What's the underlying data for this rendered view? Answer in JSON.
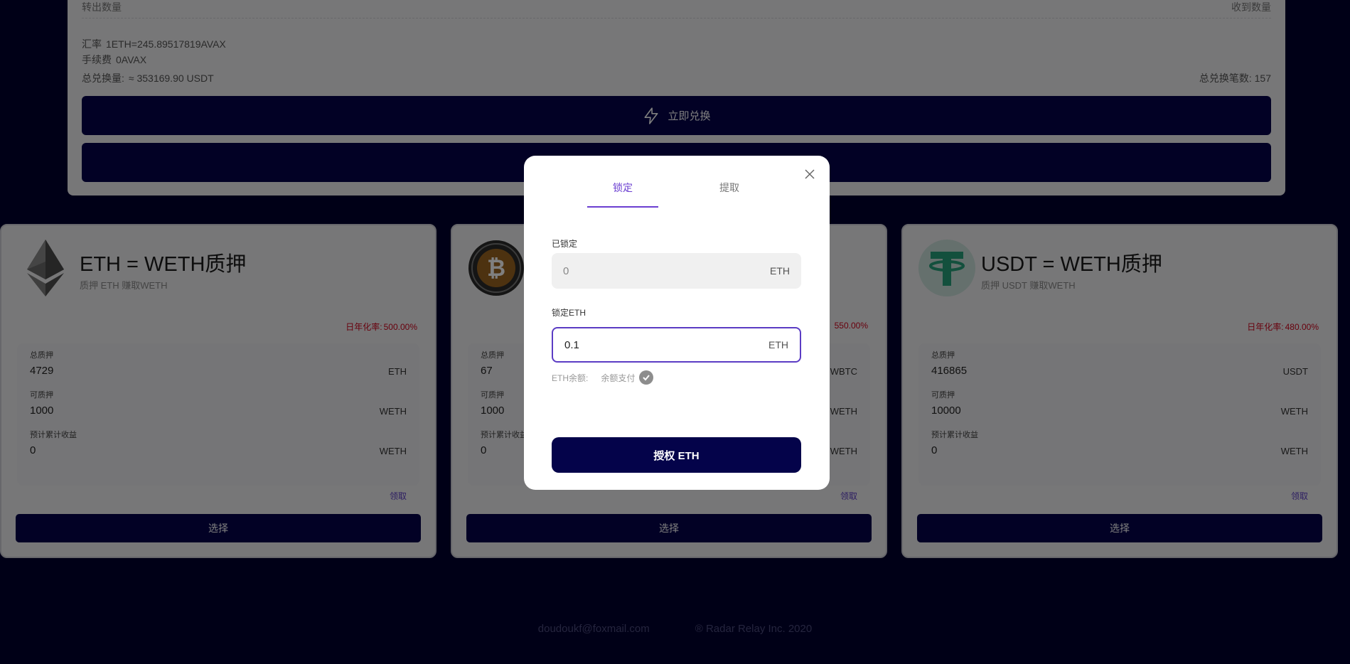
{
  "exchange": {
    "send_amount_label": "转出数量",
    "receive_amount_label": "收到数量",
    "rate_label": "汇率",
    "rate_value": "1ETH=245.89517819AVAX",
    "fee_label": "手续费",
    "fee_value": "0AVAX",
    "total_volume_label": "总兑换量:",
    "total_volume_value": "≈ 353169.90 USDT",
    "total_count_label": "总兑换笔数:",
    "total_count_value": "157",
    "exchange_button": "立即兑换"
  },
  "cards": [
    {
      "icon": "ethereum-icon",
      "title": "ETH = WETH质押",
      "subtitle": "质押 ETH 赚取WETH",
      "apy_label": "日年化率:",
      "apy_value": "500.00%",
      "total_stake_label": "总质押",
      "total_stake_value": "4729",
      "total_stake_unit": "ETH",
      "available_label": "可质押",
      "available_value": "1000",
      "available_unit": "WETH",
      "earnings_label": "预计累计收益",
      "earnings_value": "0",
      "earnings_unit": "WETH",
      "claim_label": "领取",
      "select_label": "选择"
    },
    {
      "icon": "bitcoin-icon",
      "title": "",
      "subtitle": "",
      "apy_label": "",
      "apy_value": "550.00%",
      "total_stake_label": "总质押",
      "total_stake_value": "67",
      "total_stake_unit": "WBTC",
      "available_label": "可质押",
      "available_value": "1000",
      "available_unit": "WETH",
      "earnings_label": "预计累计收益",
      "earnings_value": "0",
      "earnings_unit": "WETH",
      "claim_label": "领取",
      "select_label": "选择"
    },
    {
      "icon": "tether-icon",
      "title": "USDT = WETH质押",
      "subtitle": "质押 USDT 赚取WETH",
      "apy_label": "日年化率:",
      "apy_value": "480.00%",
      "total_stake_label": "总质押",
      "total_stake_value": "416865",
      "total_stake_unit": "USDT",
      "available_label": "可质押",
      "available_value": "10000",
      "available_unit": "WETH",
      "earnings_label": "预计累计收益",
      "earnings_value": "0",
      "earnings_unit": "WETH",
      "claim_label": "领取",
      "select_label": "选择"
    }
  ],
  "footer": {
    "email": "doudoukf@foxmail.com",
    "copyright": "® Radar Relay Inc. 2020"
  },
  "modal": {
    "tab_lock": "锁定",
    "tab_withdraw": "提取",
    "locked_label": "已锁定",
    "locked_value": "0",
    "locked_unit": "ETH",
    "lock_input_label": "锁定ETH",
    "lock_input_value": "0.1",
    "lock_input_unit": "ETH",
    "balance_label": "ETH余额:",
    "balance_pay_label": "余额支付",
    "approve_button": "授权 ETH"
  },
  "colors": {
    "background": "#01002e",
    "primary_button": "#04034a",
    "accent_purple": "#6b3fd1",
    "apy_red": "#d0021b",
    "tether_green": "#26a17b",
    "bitcoin_orange": "#f7931a"
  }
}
